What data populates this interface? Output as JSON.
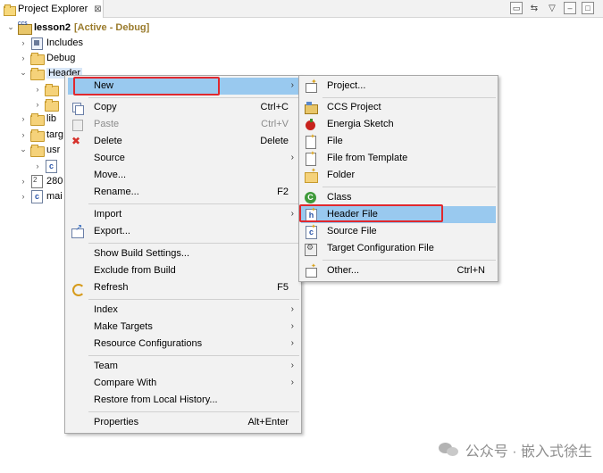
{
  "view": {
    "tab_title": "Project Explorer",
    "tab_close": "⊠"
  },
  "toolbar": {
    "collapse_icon": "collapse-all-icon",
    "link_icon": "link-with-editor-icon",
    "menu_icon": "view-menu-icon",
    "minimize_icon": "minimize-icon",
    "maximize_icon": "maximize-icon"
  },
  "tree": {
    "project_name": "lesson2",
    "project_status": "[Active - Debug]",
    "items": [
      {
        "label": "Includes"
      },
      {
        "label": "Debug"
      },
      {
        "label": "Header"
      },
      {
        "label": "lib"
      },
      {
        "label": "targ"
      },
      {
        "label": "usr"
      },
      {
        "label": "280"
      },
      {
        "label": "mai"
      }
    ]
  },
  "context_menu": {
    "items": [
      {
        "label": "New",
        "shortcut": ""
      },
      {
        "label": "Copy",
        "shortcut": "Ctrl+C"
      },
      {
        "label": "Paste",
        "shortcut": "Ctrl+V"
      },
      {
        "label": "Delete",
        "shortcut": "Delete"
      },
      {
        "label": "Source",
        "shortcut": ""
      },
      {
        "label": "Move...",
        "shortcut": ""
      },
      {
        "label": "Rename...",
        "shortcut": "F2"
      },
      {
        "label": "Import",
        "shortcut": ""
      },
      {
        "label": "Export...",
        "shortcut": ""
      },
      {
        "label": "Show Build Settings...",
        "shortcut": ""
      },
      {
        "label": "Exclude from Build",
        "shortcut": ""
      },
      {
        "label": "Refresh",
        "shortcut": "F5"
      },
      {
        "label": "Index",
        "shortcut": ""
      },
      {
        "label": "Make Targets",
        "shortcut": ""
      },
      {
        "label": "Resource Configurations",
        "shortcut": ""
      },
      {
        "label": "Team",
        "shortcut": ""
      },
      {
        "label": "Compare With",
        "shortcut": ""
      },
      {
        "label": "Restore from Local History...",
        "shortcut": ""
      },
      {
        "label": "Properties",
        "shortcut": "Alt+Enter"
      }
    ]
  },
  "submenu": {
    "items": [
      {
        "label": "Project...",
        "shortcut": ""
      },
      {
        "label": "CCS Project",
        "shortcut": ""
      },
      {
        "label": "Energia Sketch",
        "shortcut": ""
      },
      {
        "label": "File",
        "shortcut": ""
      },
      {
        "label": "File from Template",
        "shortcut": ""
      },
      {
        "label": "Folder",
        "shortcut": ""
      },
      {
        "label": "Class",
        "shortcut": ""
      },
      {
        "label": "Header File",
        "shortcut": ""
      },
      {
        "label": "Source File",
        "shortcut": ""
      },
      {
        "label": "Target Configuration File",
        "shortcut": ""
      },
      {
        "label": "Other...",
        "shortcut": "Ctrl+N"
      }
    ]
  },
  "arrow": "›",
  "colors": {
    "highlight": "#99c9ef",
    "callout_red": "#e0282e",
    "active_label": "#9a7b2c"
  },
  "watermark": {
    "text": "公众号 · 嵌入式徐生"
  }
}
